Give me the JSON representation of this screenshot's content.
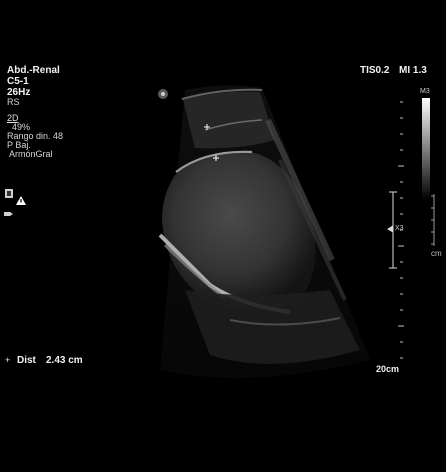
{
  "preset": {
    "exam": "Abd.-Renal",
    "probe": "C5-1",
    "frame_rate": "26Hz",
    "mode_abbrev": "RS"
  },
  "imaging": {
    "mode": "2D",
    "gain": "49%",
    "dynamic_range": "Rango din. 48",
    "power": "P Baj.",
    "harmonics": "ArmónGral"
  },
  "indices": {
    "tis": "TIS0.2",
    "mi": "MI 1.3"
  },
  "grayscale_map": {
    "label": "M3"
  },
  "scale": {
    "focus_marker": "X3",
    "cm_label": "cm",
    "depth": "20cm"
  },
  "measurement": {
    "marker": "+",
    "label": "Dist",
    "value": "2.43 cm"
  },
  "icons": {
    "orientation": "orientation-marker-icon",
    "warning": "warning-icon",
    "transducer": "transducer-icon",
    "caliper": "caliper-icon"
  }
}
